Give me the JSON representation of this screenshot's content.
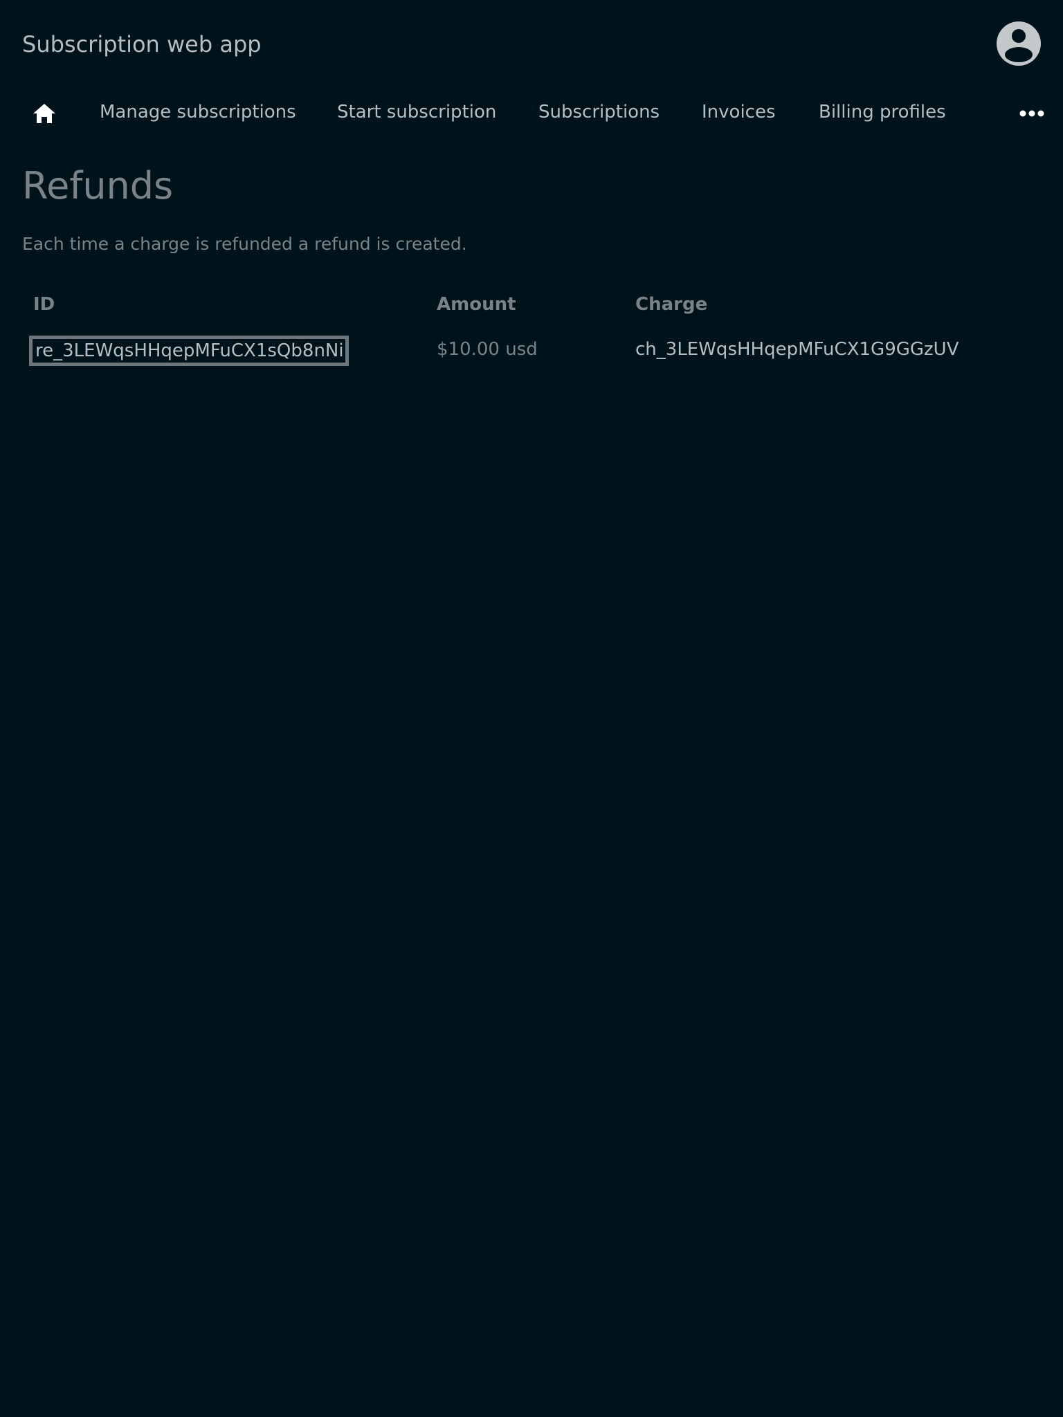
{
  "header": {
    "title": "Subscription web app",
    "avatar_icon": "user-circle-icon"
  },
  "nav": {
    "home_icon": "home-icon",
    "items": [
      {
        "label": "Manage subscriptions"
      },
      {
        "label": "Start subscription"
      },
      {
        "label": "Subscriptions"
      },
      {
        "label": "Invoices"
      },
      {
        "label": "Billing profiles"
      }
    ],
    "more_icon": "more-horizontal-icon"
  },
  "page": {
    "title": "Refunds",
    "description": "Each time a charge is refunded a refund is created."
  },
  "table": {
    "columns": [
      "ID",
      "Amount",
      "Charge"
    ],
    "rows": [
      {
        "id": "re_3LEWqsHHqepMFuCX1sQb8nNi",
        "amount": "$10.00 usd",
        "charge": "ch_3LEWqsHHqepMFuCX1G9GGzUV"
      }
    ]
  },
  "colors": {
    "background": "#00131a",
    "text_primary": "#b6bec2",
    "text_muted": "#7a8488",
    "focus_outline": "#6d767b"
  }
}
